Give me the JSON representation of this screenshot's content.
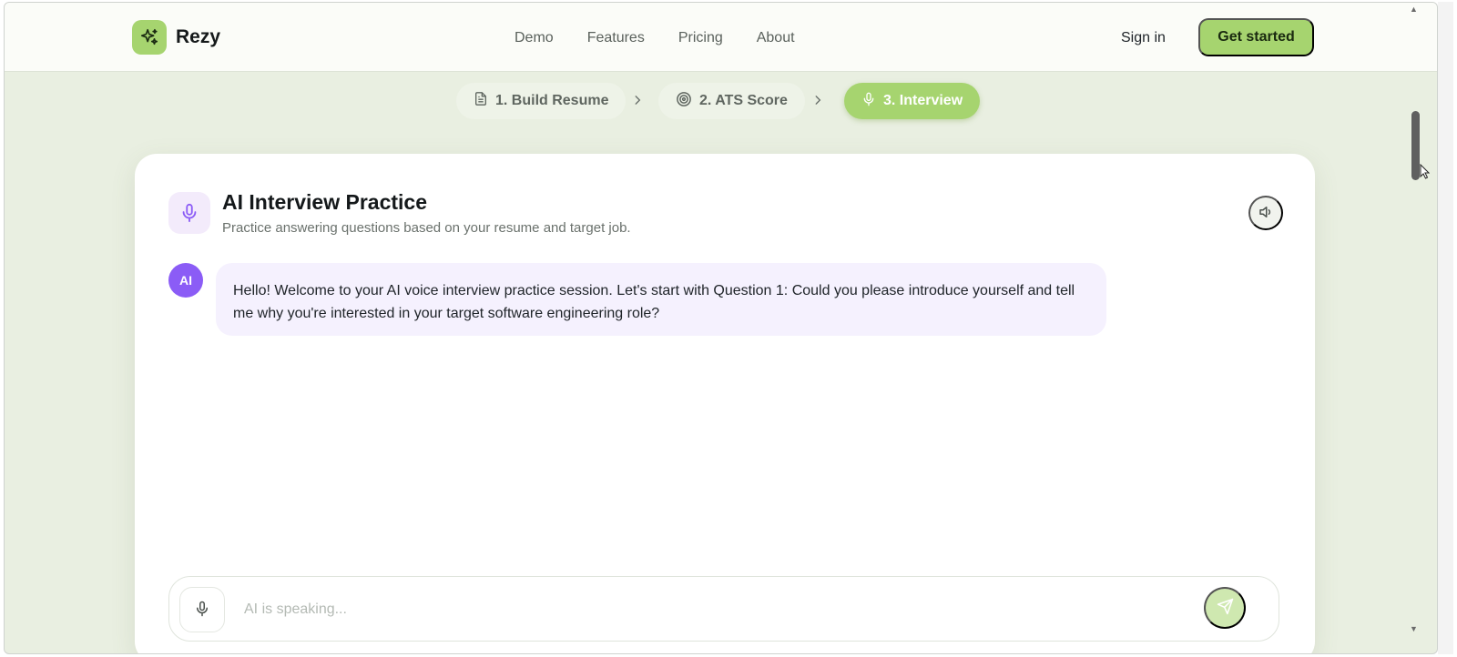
{
  "brand": {
    "name": "Rezy",
    "accent": "#a6d46f",
    "icon": "sparkle-icon"
  },
  "nav": {
    "links": [
      "Demo",
      "Features",
      "Pricing",
      "About"
    ],
    "sign_in": "Sign in",
    "cta": "Get started"
  },
  "steps": [
    {
      "label": "1. Build Resume",
      "icon": "document-icon",
      "active": false
    },
    {
      "label": "2. ATS Score",
      "icon": "target-icon",
      "active": false
    },
    {
      "label": "3. Interview",
      "icon": "microphone-icon",
      "active": true
    }
  ],
  "interview": {
    "title": "AI Interview Practice",
    "subtitle": "Practice answering questions based on your resume and target job.",
    "speaker_icon": "speaker-icon",
    "message": {
      "sender": "AI",
      "avatar_color": "#8b5cf6",
      "text": "Hello! Welcome to your AI voice interview practice session. Let's start with Question 1: Could you please introduce yourself and tell me why you're interested in your target software engineering role?"
    },
    "input": {
      "value": "",
      "placeholder": "AI is speaking..."
    }
  }
}
